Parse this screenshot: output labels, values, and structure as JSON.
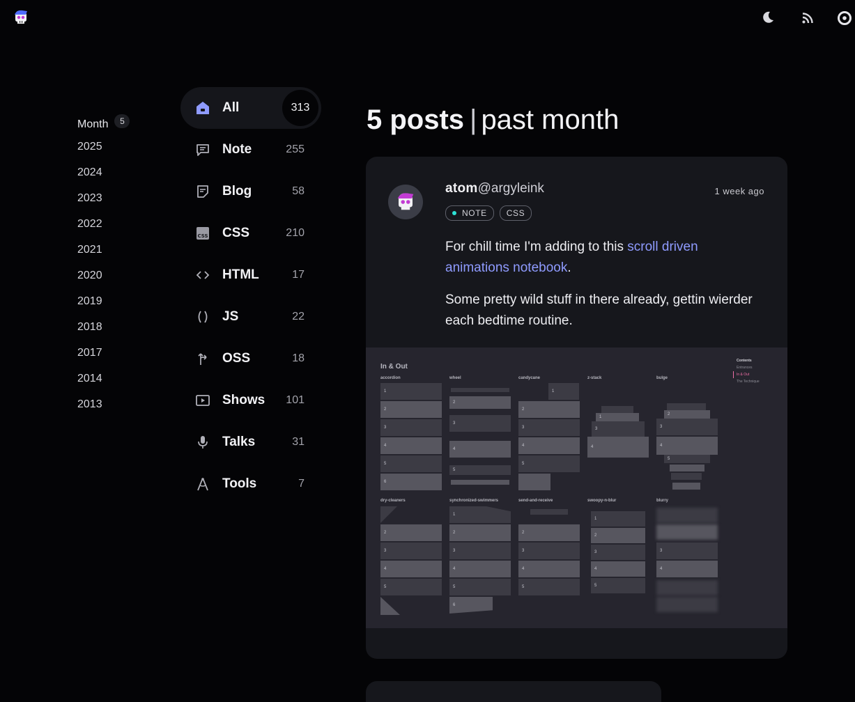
{
  "nav": {
    "logo_icon": "skull-logo-icon",
    "theme_icon": "moon-icon",
    "rss_icon": "rss-icon",
    "menu_icon": "circle-menu-icon"
  },
  "years": {
    "month_label": "Month",
    "month_count": "5",
    "items": [
      "2025",
      "2024",
      "2023",
      "2022",
      "2021",
      "2020",
      "2019",
      "2018",
      "2017",
      "2014",
      "2013"
    ]
  },
  "categories": [
    {
      "label": "All",
      "count": "313",
      "icon": "home-icon",
      "active": true
    },
    {
      "label": "Note",
      "count": "255",
      "icon": "note-icon"
    },
    {
      "label": "Blog",
      "count": "58",
      "icon": "blog-icon"
    },
    {
      "label": "CSS",
      "count": "210",
      "icon": "css-icon"
    },
    {
      "label": "HTML",
      "count": "17",
      "icon": "code-icon"
    },
    {
      "label": "JS",
      "count": "22",
      "icon": "parens-icon"
    },
    {
      "label": "OSS",
      "count": "18",
      "icon": "branch-icon"
    },
    {
      "label": "Shows",
      "count": "101",
      "icon": "play-icon"
    },
    {
      "label": "Talks",
      "count": "31",
      "icon": "mic-icon"
    },
    {
      "label": "Tools",
      "count": "7",
      "icon": "compass-icon"
    }
  ],
  "heading": {
    "count": "5 posts",
    "separator": "|",
    "range": "past month"
  },
  "post": {
    "author_name": "atom",
    "author_handle": "@argyleink",
    "time": "1 week ago",
    "tags": [
      "NOTE",
      "CSS"
    ],
    "p1_before": "For chill time I'm adding to this ",
    "p1_link": "scroll driven animations notebook",
    "p1_after": ".",
    "p2": "Some pretty wild stuff in there already, gettin wierder each bedtime routine."
  },
  "screenshot": {
    "title": "In & Out",
    "columns_top": [
      "accordion",
      "wheel",
      "candycane",
      "z-stack",
      "bulge"
    ],
    "columns_bottom": [
      "dry-cleaners",
      "synchronized-swimmers",
      "send-and-receive",
      "swoopy-n-blur",
      "blurry"
    ],
    "toc_title": "Contents",
    "toc_items": [
      "Entrances",
      "In & Out",
      "The Technique"
    ],
    "numbers": [
      "1",
      "2",
      "3",
      "4",
      "5",
      "6"
    ]
  },
  "colors": {
    "background": "#040406",
    "card": "#16171c",
    "link": "#8f9bff",
    "note_dot": "#2de2d6",
    "home_icon": "#8f9bff"
  }
}
